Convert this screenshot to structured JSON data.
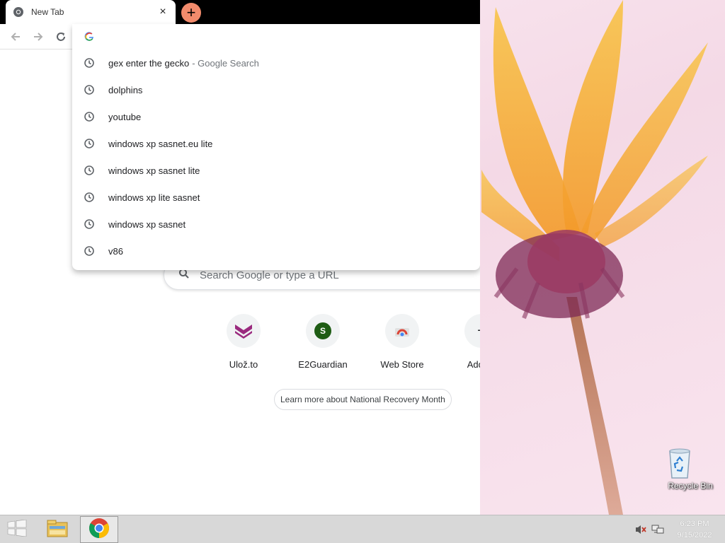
{
  "browser": {
    "tab": {
      "title": "New Tab",
      "close_glyph": "×"
    },
    "new_tab_glyph": "+",
    "omnibox": {
      "value": "",
      "suggestions": [
        {
          "text": "gex enter the gecko",
          "description": "- Google Search"
        },
        {
          "text": "dolphins",
          "description": ""
        },
        {
          "text": "youtube",
          "description": ""
        },
        {
          "text": "windows xp sasnet.eu lite",
          "description": ""
        },
        {
          "text": "windows xp sasnet lite",
          "description": ""
        },
        {
          "text": "windows xp lite sasnet",
          "description": ""
        },
        {
          "text": "windows xp sasnet",
          "description": ""
        },
        {
          "text": "v86",
          "description": ""
        }
      ]
    },
    "ntp": {
      "search_placeholder": "Search Google or type a URL",
      "shortcuts": [
        {
          "label": "Ulož.to",
          "icon": "uloz-to-icon"
        },
        {
          "label": "E2Guardian",
          "icon": "e2guardian-icon",
          "letter": "S"
        },
        {
          "label": "Web Store",
          "icon": "web-store-icon"
        },
        {
          "label": "Add sh",
          "icon": "add-shortcut-icon",
          "glyph": "+"
        }
      ],
      "promo": "Learn more about National Recovery Month"
    }
  },
  "desktop": {
    "icons": [
      {
        "label": "Recycle Bin",
        "icon": "recycle-bin-icon"
      }
    ]
  },
  "taskbar": {
    "clock_time": "6:23 PM",
    "clock_date": "9/15/2022",
    "colors": {
      "bar": "#d8d8d8",
      "accent": "#f28b6c"
    }
  }
}
